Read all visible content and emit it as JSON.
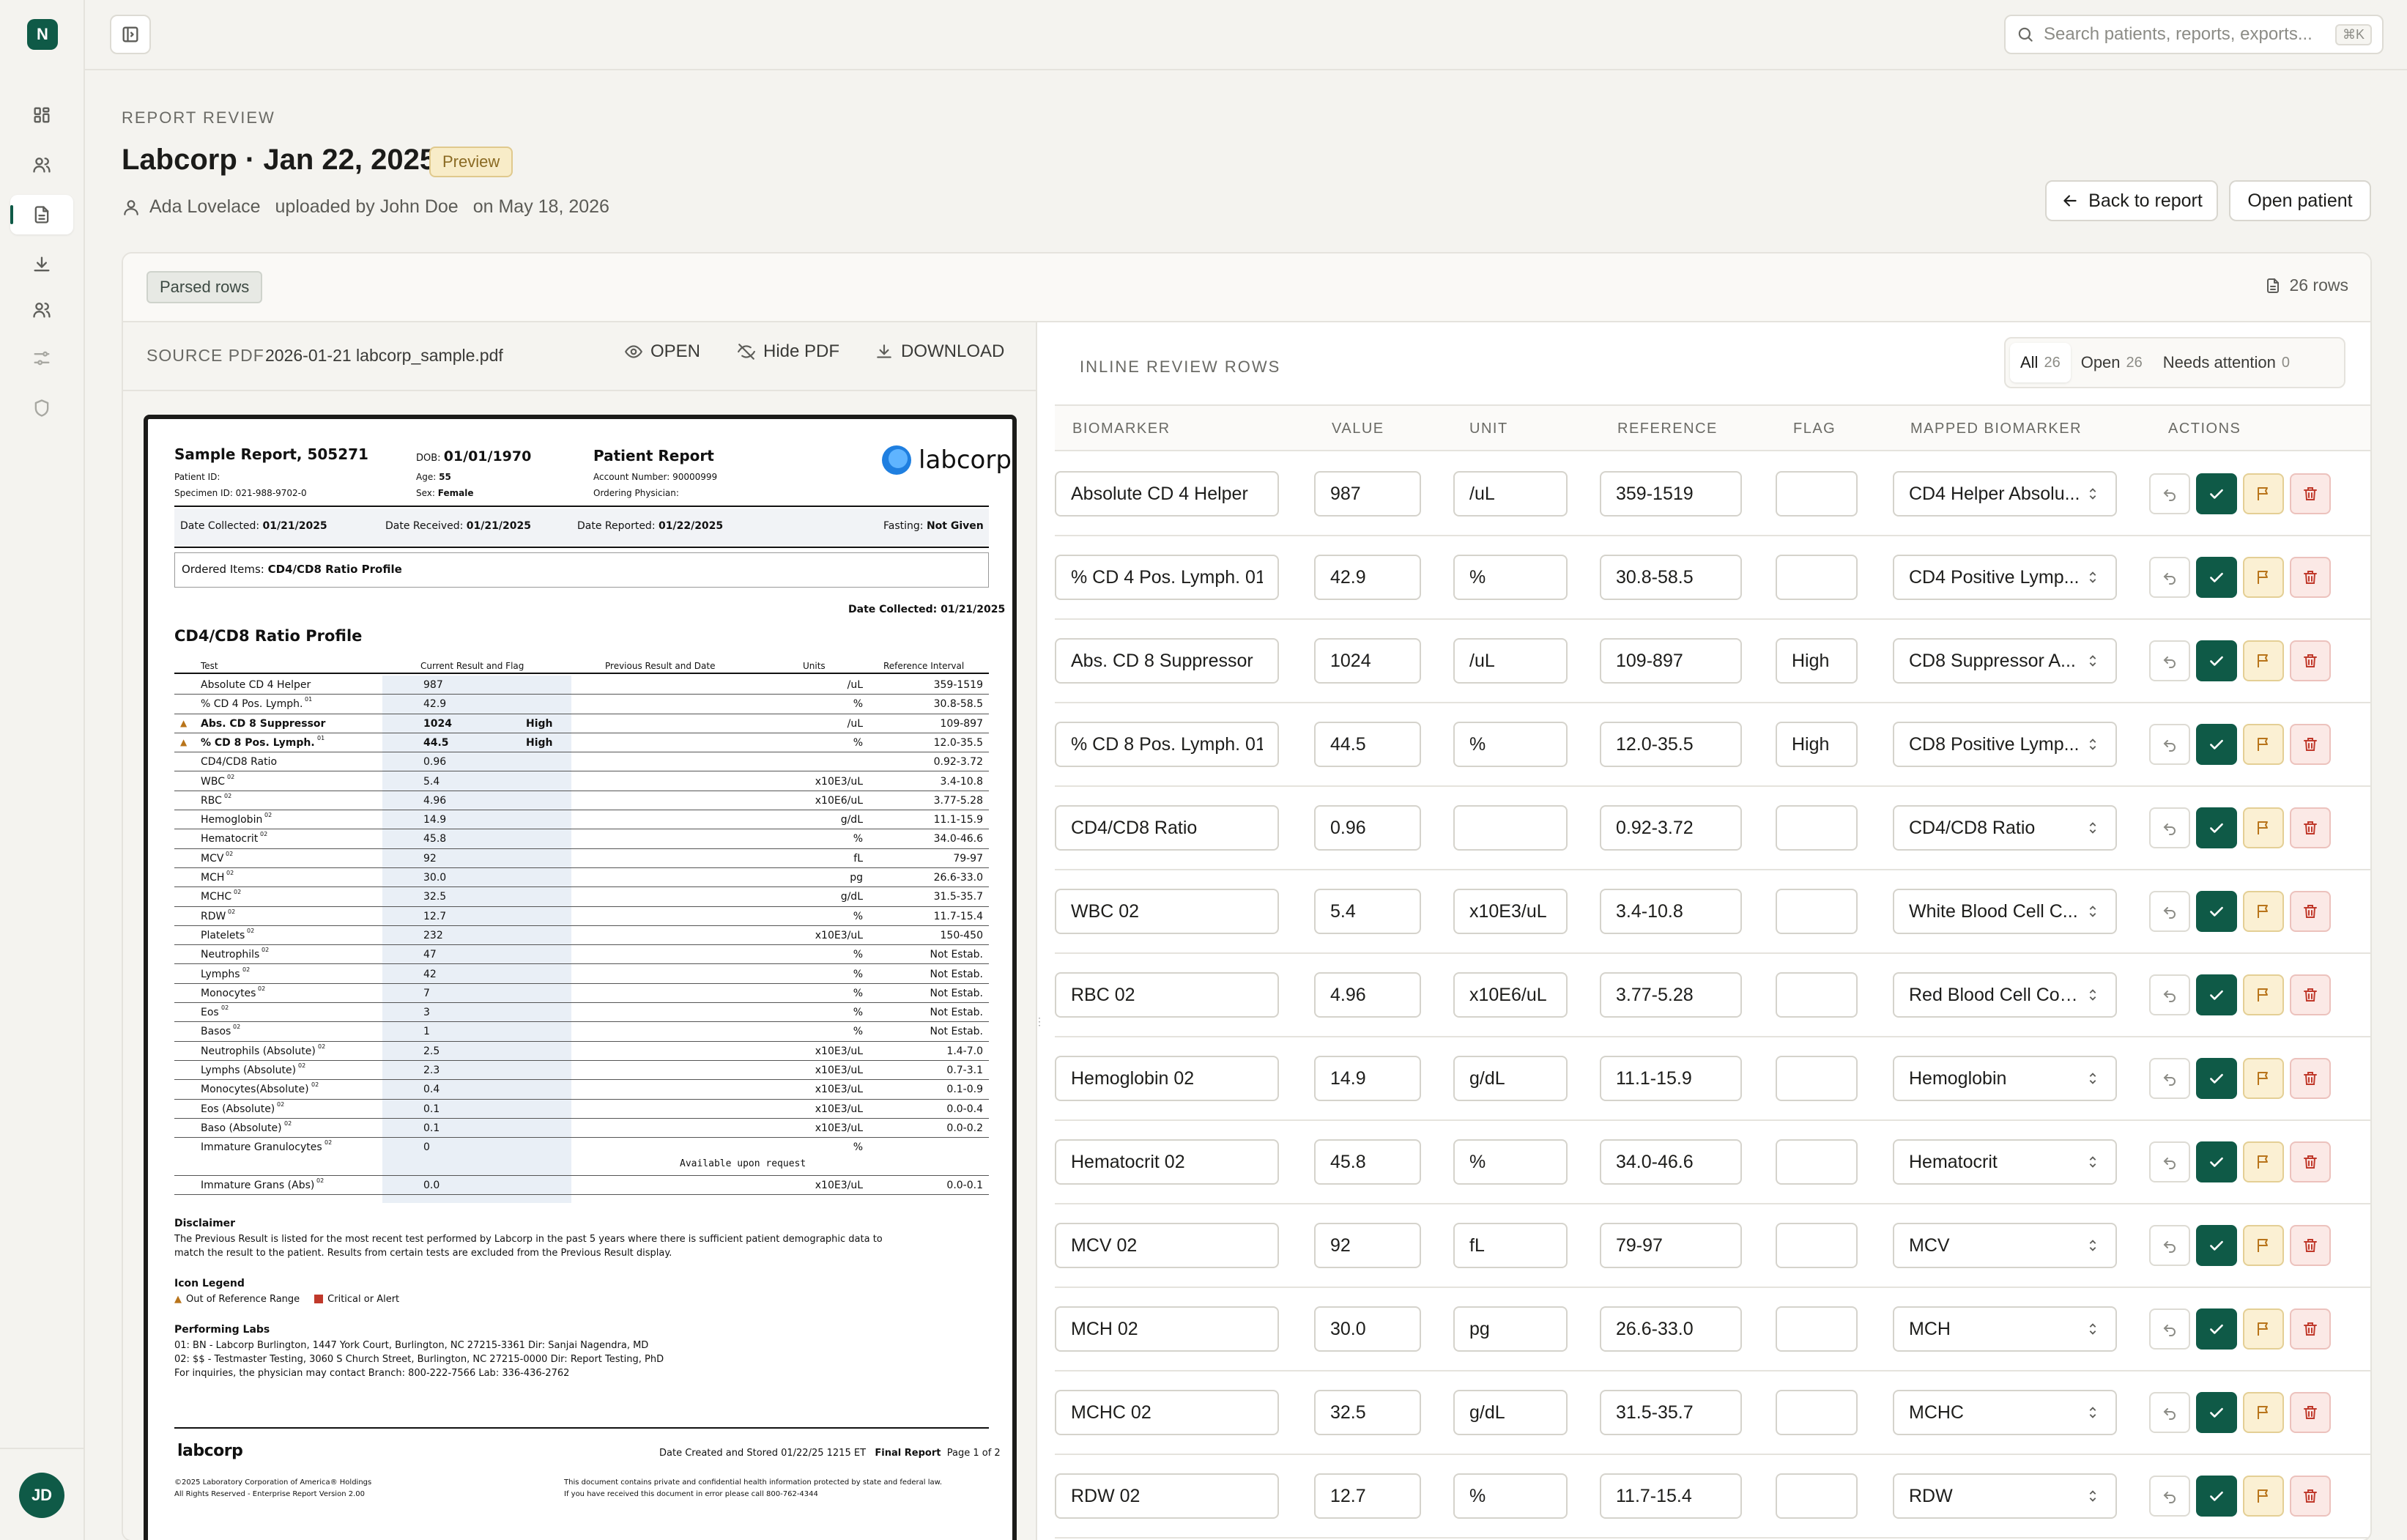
{
  "app": {
    "logo_letter": "N",
    "user_initials": "JD"
  },
  "sidebar": {
    "items": [
      {
        "name": "dashboard",
        "icon": "grid-icon"
      },
      {
        "name": "patients",
        "icon": "users-icon"
      },
      {
        "name": "reports",
        "icon": "file-icon",
        "active": true
      },
      {
        "name": "exports",
        "icon": "download-icon"
      },
      {
        "name": "team",
        "icon": "users-icon"
      },
      {
        "name": "settings",
        "icon": "sliders-icon"
      },
      {
        "name": "security",
        "icon": "shield-icon"
      }
    ]
  },
  "search": {
    "placeholder": "Search patients, reports, exports...",
    "shortcut": "⌘K"
  },
  "header": {
    "eyebrow": "REPORT REVIEW",
    "title": "Labcorp · Jan 22, 2025",
    "badge": "Preview",
    "patient": "Ada Lovelace",
    "uploaded_by": "uploaded by John Doe",
    "uploaded_on": "on May 18, 2026",
    "back_label": "Back to report",
    "open_patient_label": "Open patient"
  },
  "panel": {
    "tag": "Parsed rows",
    "rows_count": "26 rows"
  },
  "pdf": {
    "label": "SOURCE PDF",
    "filename": "2026-01-21 labcorp_sample.pdf",
    "open_label": "OPEN",
    "hide_label": "Hide PDF",
    "download_label": "DOWNLOAD",
    "doc": {
      "sample_report": "Sample Report, 505271",
      "patient_id": "Patient ID:",
      "specimen_id": "Specimen ID: 021-988-9702-0",
      "dob_label": "DOB:",
      "dob": "01/01/1970",
      "age_label": "Age:",
      "age": "55",
      "sex_label": "Sex:",
      "sex": "Female",
      "report_title": "Patient Report",
      "account": "Account Number: 90000999",
      "physician": "Ordering Physician:",
      "brand": "labcorp",
      "date_collected_label": "Date Collected:",
      "date_collected": "01/21/2025",
      "date_received_label": "Date Received:",
      "date_received": "01/21/2025",
      "date_reported_label": "Date Reported:",
      "date_reported": "01/22/2025",
      "fasting_label": "Fasting:",
      "fasting": "Not Given",
      "ordered_label": "Ordered Items:",
      "ordered": "CD4/CD8 Ratio Profile",
      "date_collected2": "Date Collected: 01/21/2025",
      "profile_title": "CD4/CD8 Ratio Profile",
      "col_test": "Test",
      "col_current": "Current Result and Flag",
      "col_previous": "Previous Result and Date",
      "col_units": "Units",
      "col_ref": "Reference Interval",
      "rows": [
        {
          "test": "Absolute CD 4 Helper",
          "sup": "",
          "val": "987",
          "flag": "",
          "unit": "/uL",
          "ref": "359-1519"
        },
        {
          "test": "% CD 4 Pos. Lymph.",
          "sup": "01",
          "val": "42.9",
          "flag": "",
          "unit": "%",
          "ref": "30.8-58.5"
        },
        {
          "test": "Abs. CD 8 Suppressor",
          "sup": "",
          "val": "1024",
          "flag": "High",
          "unit": "/uL",
          "ref": "109-897",
          "warn": true
        },
        {
          "test": "% CD 8 Pos. Lymph.",
          "sup": "01",
          "val": "44.5",
          "flag": "High",
          "unit": "%",
          "ref": "12.0-35.5",
          "warn": true
        },
        {
          "test": "CD4/CD8 Ratio",
          "sup": "",
          "val": "0.96",
          "flag": "",
          "unit": "",
          "ref": "0.92-3.72"
        },
        {
          "test": "WBC",
          "sup": "02",
          "val": "5.4",
          "flag": "",
          "unit": "x10E3/uL",
          "ref": "3.4-10.8"
        },
        {
          "test": "RBC",
          "sup": "02",
          "val": "4.96",
          "flag": "",
          "unit": "x10E6/uL",
          "ref": "3.77-5.28"
        },
        {
          "test": "Hemoglobin",
          "sup": "02",
          "val": "14.9",
          "flag": "",
          "unit": "g/dL",
          "ref": "11.1-15.9"
        },
        {
          "test": "Hematocrit",
          "sup": "02",
          "val": "45.8",
          "flag": "",
          "unit": "%",
          "ref": "34.0-46.6"
        },
        {
          "test": "MCV",
          "sup": "02",
          "val": "92",
          "flag": "",
          "unit": "fL",
          "ref": "79-97"
        },
        {
          "test": "MCH",
          "sup": "02",
          "val": "30.0",
          "flag": "",
          "unit": "pg",
          "ref": "26.6-33.0"
        },
        {
          "test": "MCHC",
          "sup": "02",
          "val": "32.5",
          "flag": "",
          "unit": "g/dL",
          "ref": "31.5-35.7"
        },
        {
          "test": "RDW",
          "sup": "02",
          "val": "12.7",
          "flag": "",
          "unit": "%",
          "ref": "11.7-15.4"
        },
        {
          "test": "Platelets",
          "sup": "02",
          "val": "232",
          "flag": "",
          "unit": "x10E3/uL",
          "ref": "150-450"
        },
        {
          "test": "Neutrophils",
          "sup": "02",
          "val": "47",
          "flag": "",
          "unit": "%",
          "ref": "Not Estab."
        },
        {
          "test": "Lymphs",
          "sup": "02",
          "val": "42",
          "flag": "",
          "unit": "%",
          "ref": "Not Estab."
        },
        {
          "test": "Monocytes",
          "sup": "02",
          "val": "7",
          "flag": "",
          "unit": "%",
          "ref": "Not Estab."
        },
        {
          "test": "Eos",
          "sup": "02",
          "val": "3",
          "flag": "",
          "unit": "%",
          "ref": "Not Estab."
        },
        {
          "test": "Basos",
          "sup": "02",
          "val": "1",
          "flag": "",
          "unit": "%",
          "ref": "Not Estab."
        },
        {
          "test": "Neutrophils (Absolute)",
          "sup": "02",
          "val": "2.5",
          "flag": "",
          "unit": "x10E3/uL",
          "ref": "1.4-7.0"
        },
        {
          "test": "Lymphs (Absolute)",
          "sup": "02",
          "val": "2.3",
          "flag": "",
          "unit": "x10E3/uL",
          "ref": "0.7-3.1"
        },
        {
          "test": "Monocytes(Absolute)",
          "sup": "02",
          "val": "0.4",
          "flag": "",
          "unit": "x10E3/uL",
          "ref": "0.1-0.9"
        },
        {
          "test": "Eos (Absolute)",
          "sup": "02",
          "val": "0.1",
          "flag": "",
          "unit": "x10E3/uL",
          "ref": "0.0-0.4"
        },
        {
          "test": "Baso (Absolute)",
          "sup": "02",
          "val": "0.1",
          "flag": "",
          "unit": "x10E3/uL",
          "ref": "0.0-0.2"
        },
        {
          "test": "Immature Granulocytes",
          "sup": "02",
          "val": "0",
          "flag": "",
          "unit": "%",
          "ref": "",
          "note": "Available upon request"
        },
        {
          "test": "Immature Grans (Abs)",
          "sup": "02",
          "val": "0.0",
          "flag": "",
          "unit": "x10E3/uL",
          "ref": "0.0-0.1"
        }
      ],
      "disclaimer_title": "Disclaimer",
      "disclaimer_1": "The Previous Result is listed for the most recent test performed by Labcorp in the past 5 years where there is sufficient patient demographic data to",
      "disclaimer_2": "match the result to the patient. Results from certain tests are excluded from the Previous Result display.",
      "legend_title": "Icon Legend",
      "legend_out": "Out of Reference Range",
      "legend_crit": "Critical or Alert",
      "labs_title": "Performing Labs",
      "lab_1": "01: BN - Labcorp Burlington, 1447 York Court, Burlington, NC 27215-3361 Dir: Sanjai Nagendra, MD",
      "lab_2": "02: $$ - Testmaster Testing, 3060 S Church Street, Burlington, NC 27215-0000 Dir: Report Testing, PhD",
      "lab_3": "For inquiries, the physician may contact Branch: 800-222-7566 Lab: 336-436-2762",
      "footer_brand": "labcorp",
      "footer_date": "Date Created and Stored 01/22/25 1215 ET",
      "footer_final": "Final Report",
      "footer_page": "Page 1 of 2",
      "copyright_1": "©2025 Laboratory Corporation of America® Holdings",
      "copyright_2": "All Rights Reserved - Enterprise Report Version 2.00",
      "confidential_1": "This document contains private and confidential health information protected by state and federal law.",
      "confidential_2": "If you have received this document in error please call 800-762-4344"
    }
  },
  "review": {
    "label": "INLINE REVIEW ROWS",
    "filters": [
      {
        "label": "All",
        "count": "26",
        "selected": true
      },
      {
        "label": "Open",
        "count": "26"
      },
      {
        "label": "Needs attention",
        "count": "0"
      }
    ],
    "columns": [
      "BIOMARKER",
      "VALUE",
      "UNIT",
      "REFERENCE",
      "FLAG",
      "MAPPED BIOMARKER",
      "ACTIONS"
    ],
    "rows": [
      {
        "biomarker": "Absolute CD 4 Helper",
        "value": "987",
        "unit": "/uL",
        "reference": "359-1519",
        "flag": "",
        "mapped": "CD4 Helper Absolu..."
      },
      {
        "biomarker": "% CD 4 Pos. Lymph. 01",
        "value": "42.9",
        "unit": "%",
        "reference": "30.8-58.5",
        "flag": "",
        "mapped": "CD4 Positive Lymp..."
      },
      {
        "biomarker": "Abs. CD 8 Suppressor",
        "value": "1024",
        "unit": "/uL",
        "reference": "109-897",
        "flag": "High",
        "mapped": "CD8 Suppressor A..."
      },
      {
        "biomarker": "% CD 8 Pos. Lymph. 01",
        "value": "44.5",
        "unit": "%",
        "reference": "12.0-35.5",
        "flag": "High",
        "mapped": "CD8 Positive Lymp..."
      },
      {
        "biomarker": "CD4/CD8 Ratio",
        "value": "0.96",
        "unit": "",
        "reference": "0.92-3.72",
        "flag": "",
        "mapped": "CD4/CD8 Ratio"
      },
      {
        "biomarker": "WBC 02",
        "value": "5.4",
        "unit": "x10E3/uL",
        "reference": "3.4-10.8",
        "flag": "",
        "mapped": "White Blood Cell C..."
      },
      {
        "biomarker": "RBC 02",
        "value": "4.96",
        "unit": "x10E6/uL",
        "reference": "3.77-5.28",
        "flag": "",
        "mapped": "Red Blood Cell Cou..."
      },
      {
        "biomarker": "Hemoglobin 02",
        "value": "14.9",
        "unit": "g/dL",
        "reference": "11.1-15.9",
        "flag": "",
        "mapped": "Hemoglobin"
      },
      {
        "biomarker": "Hematocrit 02",
        "value": "45.8",
        "unit": "%",
        "reference": "34.0-46.6",
        "flag": "",
        "mapped": "Hematocrit"
      },
      {
        "biomarker": "MCV 02",
        "value": "92",
        "unit": "fL",
        "reference": "79-97",
        "flag": "",
        "mapped": "MCV"
      },
      {
        "biomarker": "MCH 02",
        "value": "30.0",
        "unit": "pg",
        "reference": "26.6-33.0",
        "flag": "",
        "mapped": "MCH"
      },
      {
        "biomarker": "MCHC 02",
        "value": "32.5",
        "unit": "g/dL",
        "reference": "31.5-35.7",
        "flag": "",
        "mapped": "MCHC"
      },
      {
        "biomarker": "RDW 02",
        "value": "12.7",
        "unit": "%",
        "reference": "11.7-15.4",
        "flag": "",
        "mapped": "RDW"
      }
    ]
  },
  "colors": {
    "accent": "#0f5a47",
    "warn": "#b8741a",
    "danger": "#c0392b",
    "badge_bg": "#f8ecc8"
  }
}
